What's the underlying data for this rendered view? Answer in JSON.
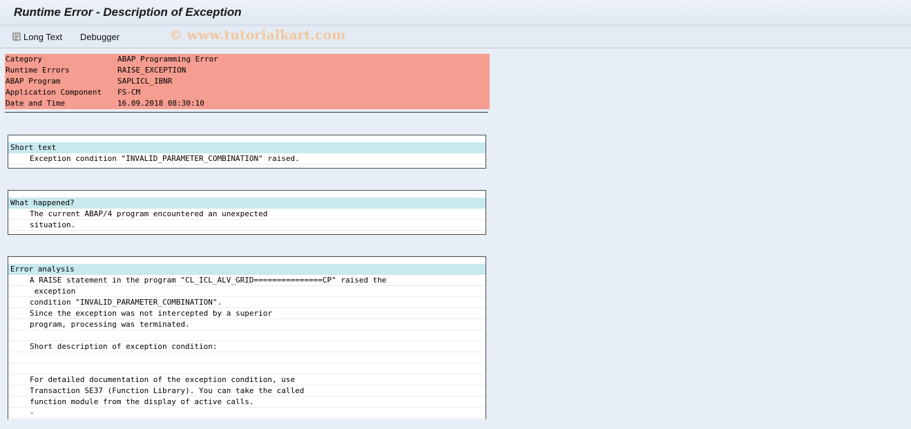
{
  "title": "Runtime Error - Description of Exception",
  "toolbar": {
    "long_text_label": "Long Text",
    "debugger_label": "Debugger",
    "watermark": "© www.tutorialkart.com"
  },
  "header": [
    {
      "key": "Category",
      "value": "ABAP Programming Error"
    },
    {
      "key": "Runtime Errors",
      "value": "RAISE_EXCEPTION"
    },
    {
      "key": "ABAP Program",
      "value": "SAPLICL_IBNR"
    },
    {
      "key": "Application Component",
      "value": "FS-CM"
    },
    {
      "key": "Date and Time",
      "value": "16.09.2018 08:30:10"
    }
  ],
  "short_text": {
    "heading": "Short text",
    "lines": [
      "Exception condition \"INVALID_PARAMETER_COMBINATION\" raised."
    ]
  },
  "what_happened": {
    "heading": "What happened?",
    "lines": [
      "The current ABAP/4 program encountered an unexpected",
      "situation."
    ]
  },
  "error_analysis": {
    "heading": "Error analysis",
    "lines": [
      "A RAISE statement in the program \"CL_ICL_ALV_GRID===============CP\" raised the",
      " exception",
      "condition \"INVALID_PARAMETER_COMBINATION\".",
      "Since the exception was not intercepted by a superior",
      "program, processing was terminated.",
      "",
      "Short description of exception condition:",
      "",
      "",
      "For detailed documentation of the exception condition, use",
      "Transaction SE37 (Function Library). You can take the called",
      "function module from the display of active calls.",
      "-"
    ]
  }
}
